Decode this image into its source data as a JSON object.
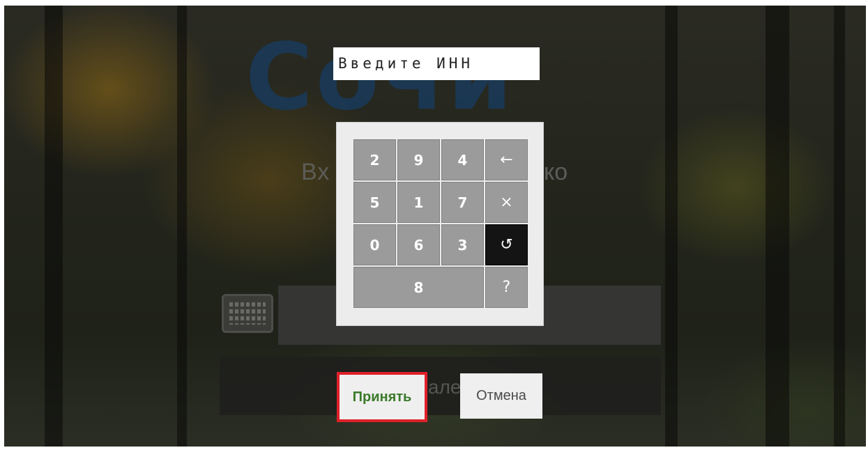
{
  "background": {
    "logo_text": "Сочи",
    "subtitle_left": "Вх",
    "subtitle_right": "ко",
    "login_bar_text": "але"
  },
  "inn_prompt": "Введите ИНН",
  "keypad": {
    "keys": [
      {
        "label": "2",
        "role": "digit"
      },
      {
        "label": "9",
        "role": "digit"
      },
      {
        "label": "4",
        "role": "digit"
      },
      {
        "label": "←",
        "role": "backspace",
        "icon": "left-arrow-icon"
      },
      {
        "label": "5",
        "role": "digit"
      },
      {
        "label": "1",
        "role": "digit"
      },
      {
        "label": "7",
        "role": "digit"
      },
      {
        "label": "×",
        "role": "clear",
        "icon": "close-icon"
      },
      {
        "label": "0",
        "role": "digit"
      },
      {
        "label": "6",
        "role": "digit"
      },
      {
        "label": "3",
        "role": "digit"
      },
      {
        "label": "↺",
        "role": "shuffle",
        "icon": "refresh-icon"
      },
      {
        "label": "8",
        "role": "digit"
      },
      {
        "label": "?",
        "role": "help",
        "icon": "help-icon"
      }
    ]
  },
  "actions": {
    "accept_label": "Принять",
    "cancel_label": "Отмена"
  },
  "colors": {
    "accept_border": "#e0202a",
    "accept_text": "#3b7a2a",
    "key_bg": "#9b9b9b",
    "key_active_bg": "#141414"
  }
}
